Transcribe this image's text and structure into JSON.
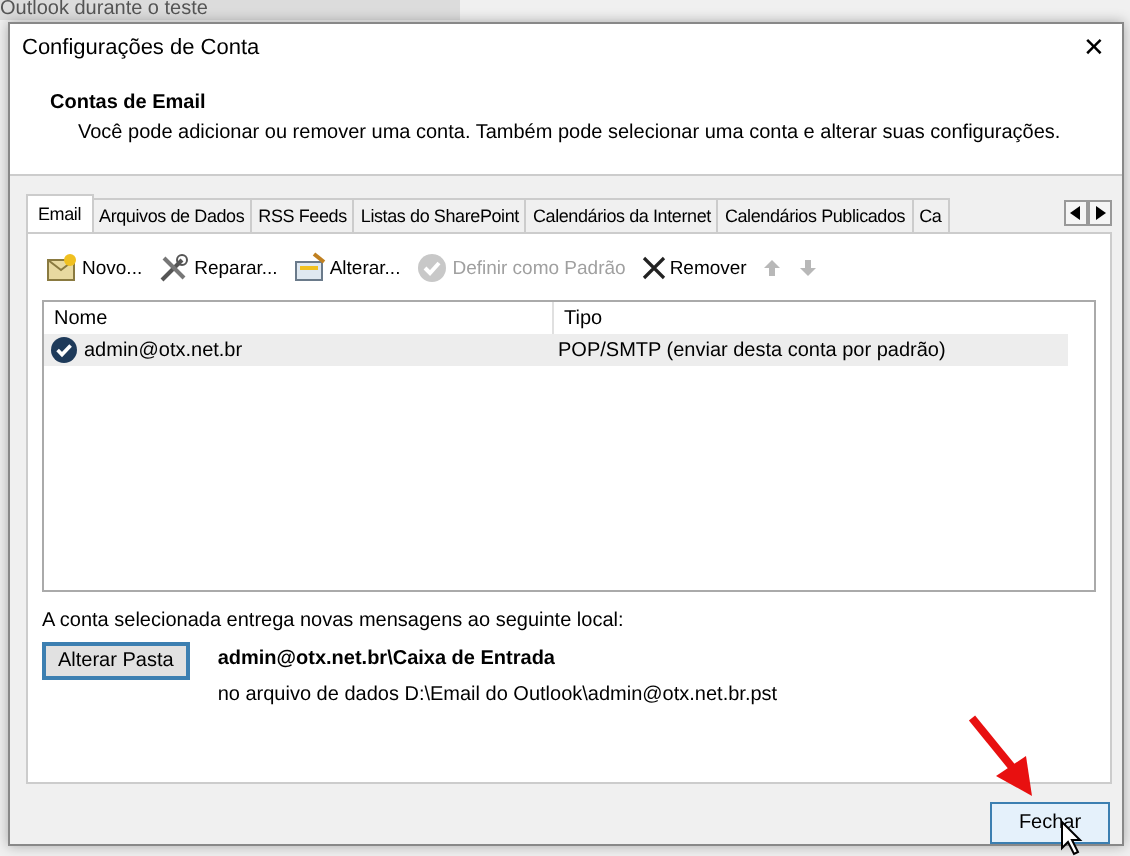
{
  "background_text": "Outlook durante o teste",
  "window": {
    "title": "Configurações de Conta",
    "close": "✕"
  },
  "header": {
    "heading": "Contas de Email",
    "description": "Você pode adicionar ou remover uma conta. Também pode selecionar uma conta e alterar suas configurações."
  },
  "tabs": [
    {
      "label": "Email",
      "selected": true
    },
    {
      "label": "Arquivos de Dados",
      "selected": false
    },
    {
      "label": "RSS Feeds",
      "selected": false
    },
    {
      "label": "Listas do SharePoint",
      "selected": false
    },
    {
      "label": "Calendários da Internet",
      "selected": false
    },
    {
      "label": "Calendários Publicados",
      "selected": false
    },
    {
      "label": "Ca",
      "selected": false
    }
  ],
  "toolbar": [
    {
      "kind": "new",
      "label": "Novo...",
      "disabled": false
    },
    {
      "kind": "repair",
      "label": "Reparar...",
      "disabled": false
    },
    {
      "kind": "change",
      "label": "Alterar...",
      "disabled": false
    },
    {
      "kind": "default",
      "label": "Definir como Padrão",
      "disabled": true
    },
    {
      "kind": "remove",
      "label": "Remover",
      "disabled": false
    },
    {
      "kind": "up",
      "disabled": true
    },
    {
      "kind": "down",
      "disabled": true
    }
  ],
  "table": {
    "columns": [
      "Nome",
      "Tipo"
    ],
    "rows": [
      {
        "name": "admin@otx.net.br",
        "type": "POP/SMTP (enviar desta conta por padrão)",
        "default": true,
        "selected": true
      }
    ]
  },
  "delivery": {
    "caption": "A conta selecionada entrega novas mensagens ao seguinte local:",
    "button": "Alterar Pasta",
    "folder": "admin@otx.net.br\\Caixa de Entrada",
    "file": "no arquivo de dados D:\\Email do Outlook\\admin@otx.net.br.pst"
  },
  "buttons": [
    "Fechar"
  ]
}
